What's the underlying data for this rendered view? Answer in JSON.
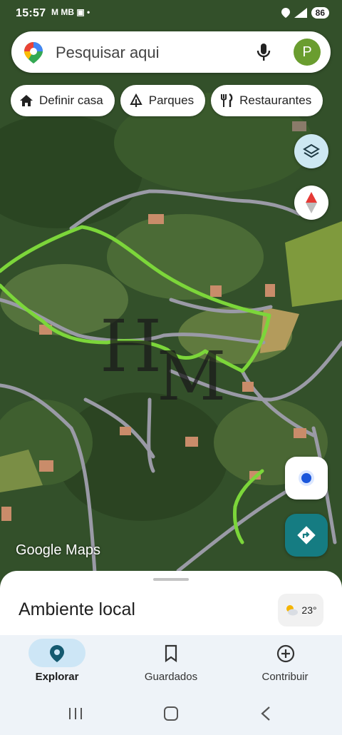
{
  "status_bar": {
    "time": "15:57",
    "left_icons": "M MB ▣ •",
    "battery": "86"
  },
  "search": {
    "placeholder": "Pesquisar aqui",
    "avatar_letter": "P"
  },
  "chips": [
    {
      "label": "Definir casa",
      "icon": "home-icon"
    },
    {
      "label": "Parques",
      "icon": "tree-icon"
    },
    {
      "label": "Restaurantes",
      "icon": "fork-knife-icon"
    }
  ],
  "map": {
    "attribution": "Google Maps",
    "watermark_text": "HM",
    "route_color": "#7cd63a",
    "road_color": "#9a9aa6"
  },
  "sheet": {
    "title": "Ambiente local",
    "temperature": "23°",
    "weather_icon": "partly-cloudy-icon"
  },
  "bottom_nav": [
    {
      "label": "Explorar",
      "icon": "location-pin-icon",
      "active": true
    },
    {
      "label": "Guardados",
      "icon": "bookmark-icon",
      "active": false
    },
    {
      "label": "Contribuir",
      "icon": "add-circle-icon",
      "active": false
    }
  ],
  "colors": {
    "accent": "#157c82",
    "avatar": "#6a9d2f",
    "nav_active": "#cde6f6"
  }
}
